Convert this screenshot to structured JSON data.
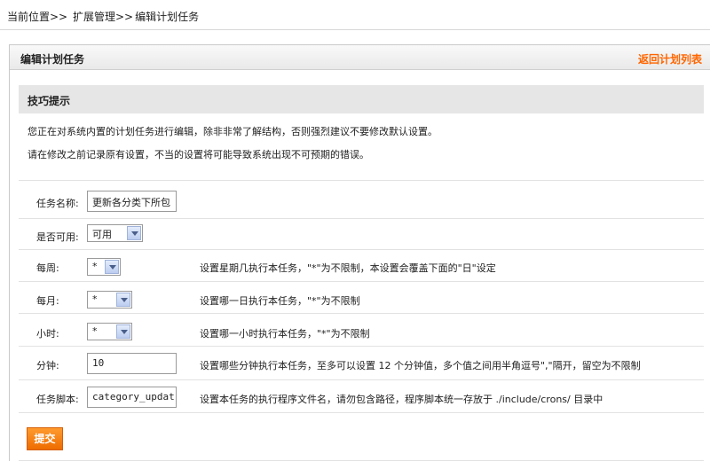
{
  "breadcrumb": {
    "current": "当前位置>>",
    "level1": "扩展管理>>",
    "level2": "编辑计划任务"
  },
  "panel": {
    "title": "编辑计划任务",
    "back_link": "返回计划列表"
  },
  "tips": {
    "title": "技巧提示",
    "line1": "您正在对系统内置的计划任务进行编辑，除非非常了解结构，否则强烈建议不要修改默认设置。",
    "line2": "请在修改之前记录原有设置，不当的设置将可能导致系统出现不可预期的错误。"
  },
  "form": {
    "task_name": {
      "label": "任务名称:",
      "value": "更新各分类下所包"
    },
    "enabled": {
      "label": "是否可用:",
      "value": "可用"
    },
    "weekday": {
      "label": "每周:",
      "value": "*",
      "hint": "设置星期几执行本任务，\"*\"为不限制，本设置会覆盖下面的\"日\"设定"
    },
    "monthday": {
      "label": "每月:",
      "value": "*",
      "hint": "设置哪一日执行本任务，\"*\"为不限制"
    },
    "hour": {
      "label": "小时:",
      "value": "*",
      "hint": "设置哪一小时执行本任务，\"*\"为不限制"
    },
    "minute": {
      "label": "分钟:",
      "value": "10",
      "hint": "设置哪些分钟执行本任务，至多可以设置 12 个分钟值，多个值之间用半角逗号\",\"隔开，留空为不限制"
    },
    "script": {
      "label": "任务脚本:",
      "value": "category_updat",
      "hint": "设置本任务的执行程序文件名，请勿包含路径，程序脚本统一存放于 ./include/crons/ 目录中"
    }
  },
  "submit_label": "提交",
  "colors": {
    "accent": "#ff6600",
    "button": "#f07a10",
    "header_bg": "#e6e6e6"
  }
}
